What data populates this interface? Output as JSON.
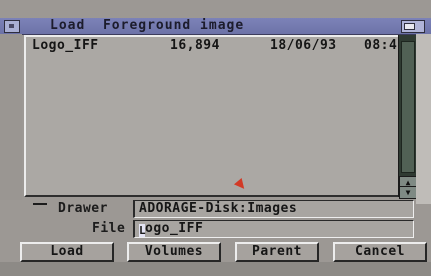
{
  "window": {
    "title": "Load  Foreground image"
  },
  "file_list": {
    "rows": [
      {
        "name": "Logo_IFF",
        "size": "16,894",
        "date": "18/06/93",
        "time": "08:4"
      }
    ]
  },
  "fields": {
    "drawer_label": "Drawer",
    "drawer_value": "ADORAGE-Disk:Images",
    "file_label": "File",
    "file_value": "ogo_IFF",
    "file_cursor_char": "L"
  },
  "buttons": {
    "load": "Load",
    "volumes": "Volumes",
    "parent": "Parent",
    "cancel": "Cancel"
  },
  "colors": {
    "title_bar": "#7c82b8",
    "list_background": "#aba8a4",
    "scrollbar": "#2f3a32",
    "pointer": "#d23a26"
  }
}
